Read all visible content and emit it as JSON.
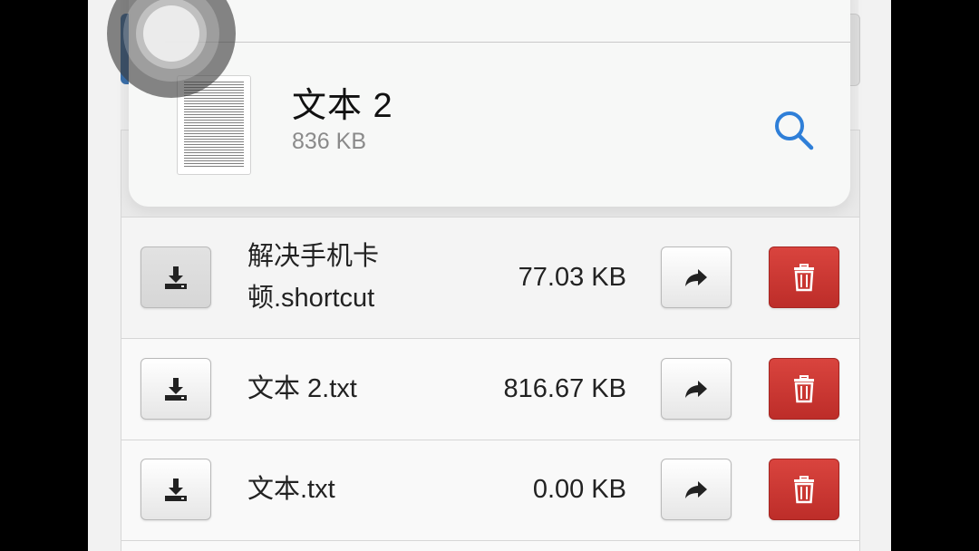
{
  "preview": {
    "title": "文本 2",
    "size": "836 KB",
    "search_icon": "search-icon"
  },
  "files": [
    {
      "name": "解决手机卡顿.shortcut",
      "size": "77.03 KB"
    },
    {
      "name": "文本 2.txt",
      "size": "816.67 KB"
    },
    {
      "name": "文本.txt",
      "size": "0.00 KB"
    }
  ],
  "icons": {
    "download": "download-icon",
    "share": "share-icon",
    "delete": "trash-icon",
    "assistive": "assistive-touch-icon"
  },
  "colors": {
    "accent": "#2f7fd8",
    "delete": "#c8322f"
  }
}
